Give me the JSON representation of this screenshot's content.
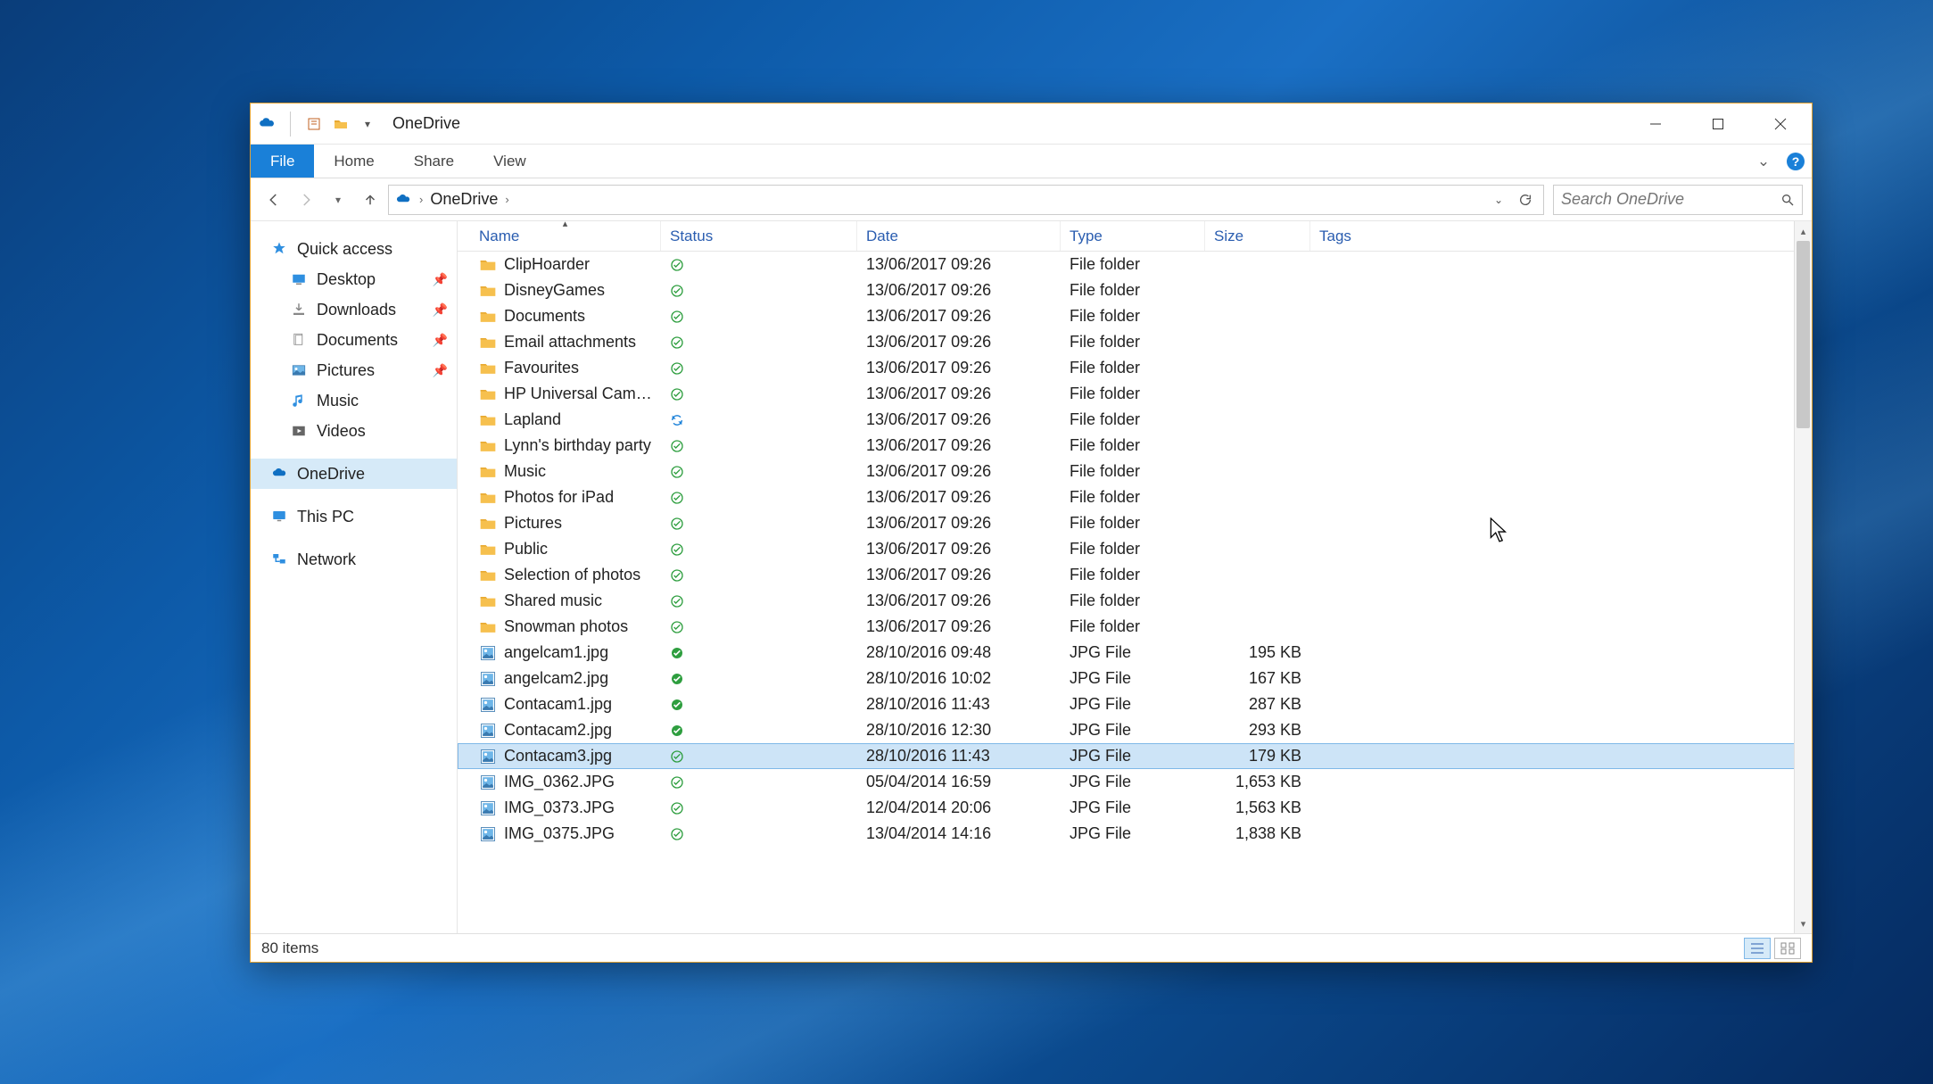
{
  "titlebar": {
    "title": "OneDrive"
  },
  "ribbon": {
    "file": "File",
    "tabs": [
      "Home",
      "Share",
      "View"
    ]
  },
  "breadcrumb": {
    "location": "OneDrive"
  },
  "search": {
    "placeholder": "Search OneDrive"
  },
  "sidebar": {
    "quick_access": "Quick access",
    "quick_items": [
      {
        "label": "Desktop",
        "pinned": true,
        "icon": "desktop"
      },
      {
        "label": "Downloads",
        "pinned": true,
        "icon": "downloads"
      },
      {
        "label": "Documents",
        "pinned": true,
        "icon": "documents"
      },
      {
        "label": "Pictures",
        "pinned": true,
        "icon": "pictures"
      },
      {
        "label": "Music",
        "pinned": false,
        "icon": "music"
      },
      {
        "label": "Videos",
        "pinned": false,
        "icon": "videos"
      }
    ],
    "onedrive": "OneDrive",
    "thispc": "This PC",
    "network": "Network"
  },
  "columns": {
    "name": "Name",
    "status": "Status",
    "date": "Date",
    "type": "Type",
    "size": "Size",
    "tags": "Tags"
  },
  "rows": [
    {
      "icon": "folder",
      "name": "ClipHoarder",
      "status": "ok",
      "date": "13/06/2017 09:26",
      "type": "File folder",
      "size": ""
    },
    {
      "icon": "folder",
      "name": "DisneyGames",
      "status": "ok",
      "date": "13/06/2017 09:26",
      "type": "File folder",
      "size": ""
    },
    {
      "icon": "folder",
      "name": "Documents",
      "status": "ok",
      "date": "13/06/2017 09:26",
      "type": "File folder",
      "size": ""
    },
    {
      "icon": "folder",
      "name": "Email attachments",
      "status": "ok",
      "date": "13/06/2017 09:26",
      "type": "File folder",
      "size": ""
    },
    {
      "icon": "folder",
      "name": "Favourites",
      "status": "ok",
      "date": "13/06/2017 09:26",
      "type": "File folder",
      "size": ""
    },
    {
      "icon": "folder",
      "name": "HP Universal Camer...",
      "status": "ok",
      "date": "13/06/2017 09:26",
      "type": "File folder",
      "size": ""
    },
    {
      "icon": "folder",
      "name": "Lapland",
      "status": "sync",
      "date": "13/06/2017 09:26",
      "type": "File folder",
      "size": ""
    },
    {
      "icon": "folder",
      "name": "Lynn's birthday party",
      "status": "ok",
      "date": "13/06/2017 09:26",
      "type": "File folder",
      "size": ""
    },
    {
      "icon": "folder",
      "name": "Music",
      "status": "ok",
      "date": "13/06/2017 09:26",
      "type": "File folder",
      "size": ""
    },
    {
      "icon": "folder",
      "name": "Photos for iPad",
      "status": "ok",
      "date": "13/06/2017 09:26",
      "type": "File folder",
      "size": ""
    },
    {
      "icon": "folder",
      "name": "Pictures",
      "status": "ok",
      "date": "13/06/2017 09:26",
      "type": "File folder",
      "size": ""
    },
    {
      "icon": "folder",
      "name": "Public",
      "status": "ok",
      "date": "13/06/2017 09:26",
      "type": "File folder",
      "size": ""
    },
    {
      "icon": "folder",
      "name": "Selection of photos",
      "status": "ok",
      "date": "13/06/2017 09:26",
      "type": "File folder",
      "size": ""
    },
    {
      "icon": "folder",
      "name": "Shared music",
      "status": "ok",
      "date": "13/06/2017 09:26",
      "type": "File folder",
      "size": ""
    },
    {
      "icon": "folder",
      "name": "Snowman photos",
      "status": "ok",
      "date": "13/06/2017 09:26",
      "type": "File folder",
      "size": ""
    },
    {
      "icon": "image",
      "name": "angelcam1.jpg",
      "status": "ok-solid",
      "date": "28/10/2016 09:48",
      "type": "JPG File",
      "size": "195 KB"
    },
    {
      "icon": "image",
      "name": "angelcam2.jpg",
      "status": "ok-solid",
      "date": "28/10/2016 10:02",
      "type": "JPG File",
      "size": "167 KB"
    },
    {
      "icon": "image",
      "name": "Contacam1.jpg",
      "status": "ok-solid",
      "date": "28/10/2016 11:43",
      "type": "JPG File",
      "size": "287 KB"
    },
    {
      "icon": "image",
      "name": "Contacam2.jpg",
      "status": "ok-solid",
      "date": "28/10/2016 12:30",
      "type": "JPG File",
      "size": "293 KB"
    },
    {
      "icon": "image",
      "name": "Contacam3.jpg",
      "status": "ok",
      "date": "28/10/2016 11:43",
      "type": "JPG File",
      "size": "179 KB",
      "selected": true
    },
    {
      "icon": "image",
      "name": "IMG_0362.JPG",
      "status": "ok",
      "date": "05/04/2014 16:59",
      "type": "JPG File",
      "size": "1,653 KB"
    },
    {
      "icon": "image",
      "name": "IMG_0373.JPG",
      "status": "ok",
      "date": "12/04/2014 20:06",
      "type": "JPG File",
      "size": "1,563 KB"
    },
    {
      "icon": "image",
      "name": "IMG_0375.JPG",
      "status": "ok",
      "date": "13/04/2014 14:16",
      "type": "JPG File",
      "size": "1,838 KB"
    }
  ],
  "statusbar": {
    "count": "80 items"
  }
}
